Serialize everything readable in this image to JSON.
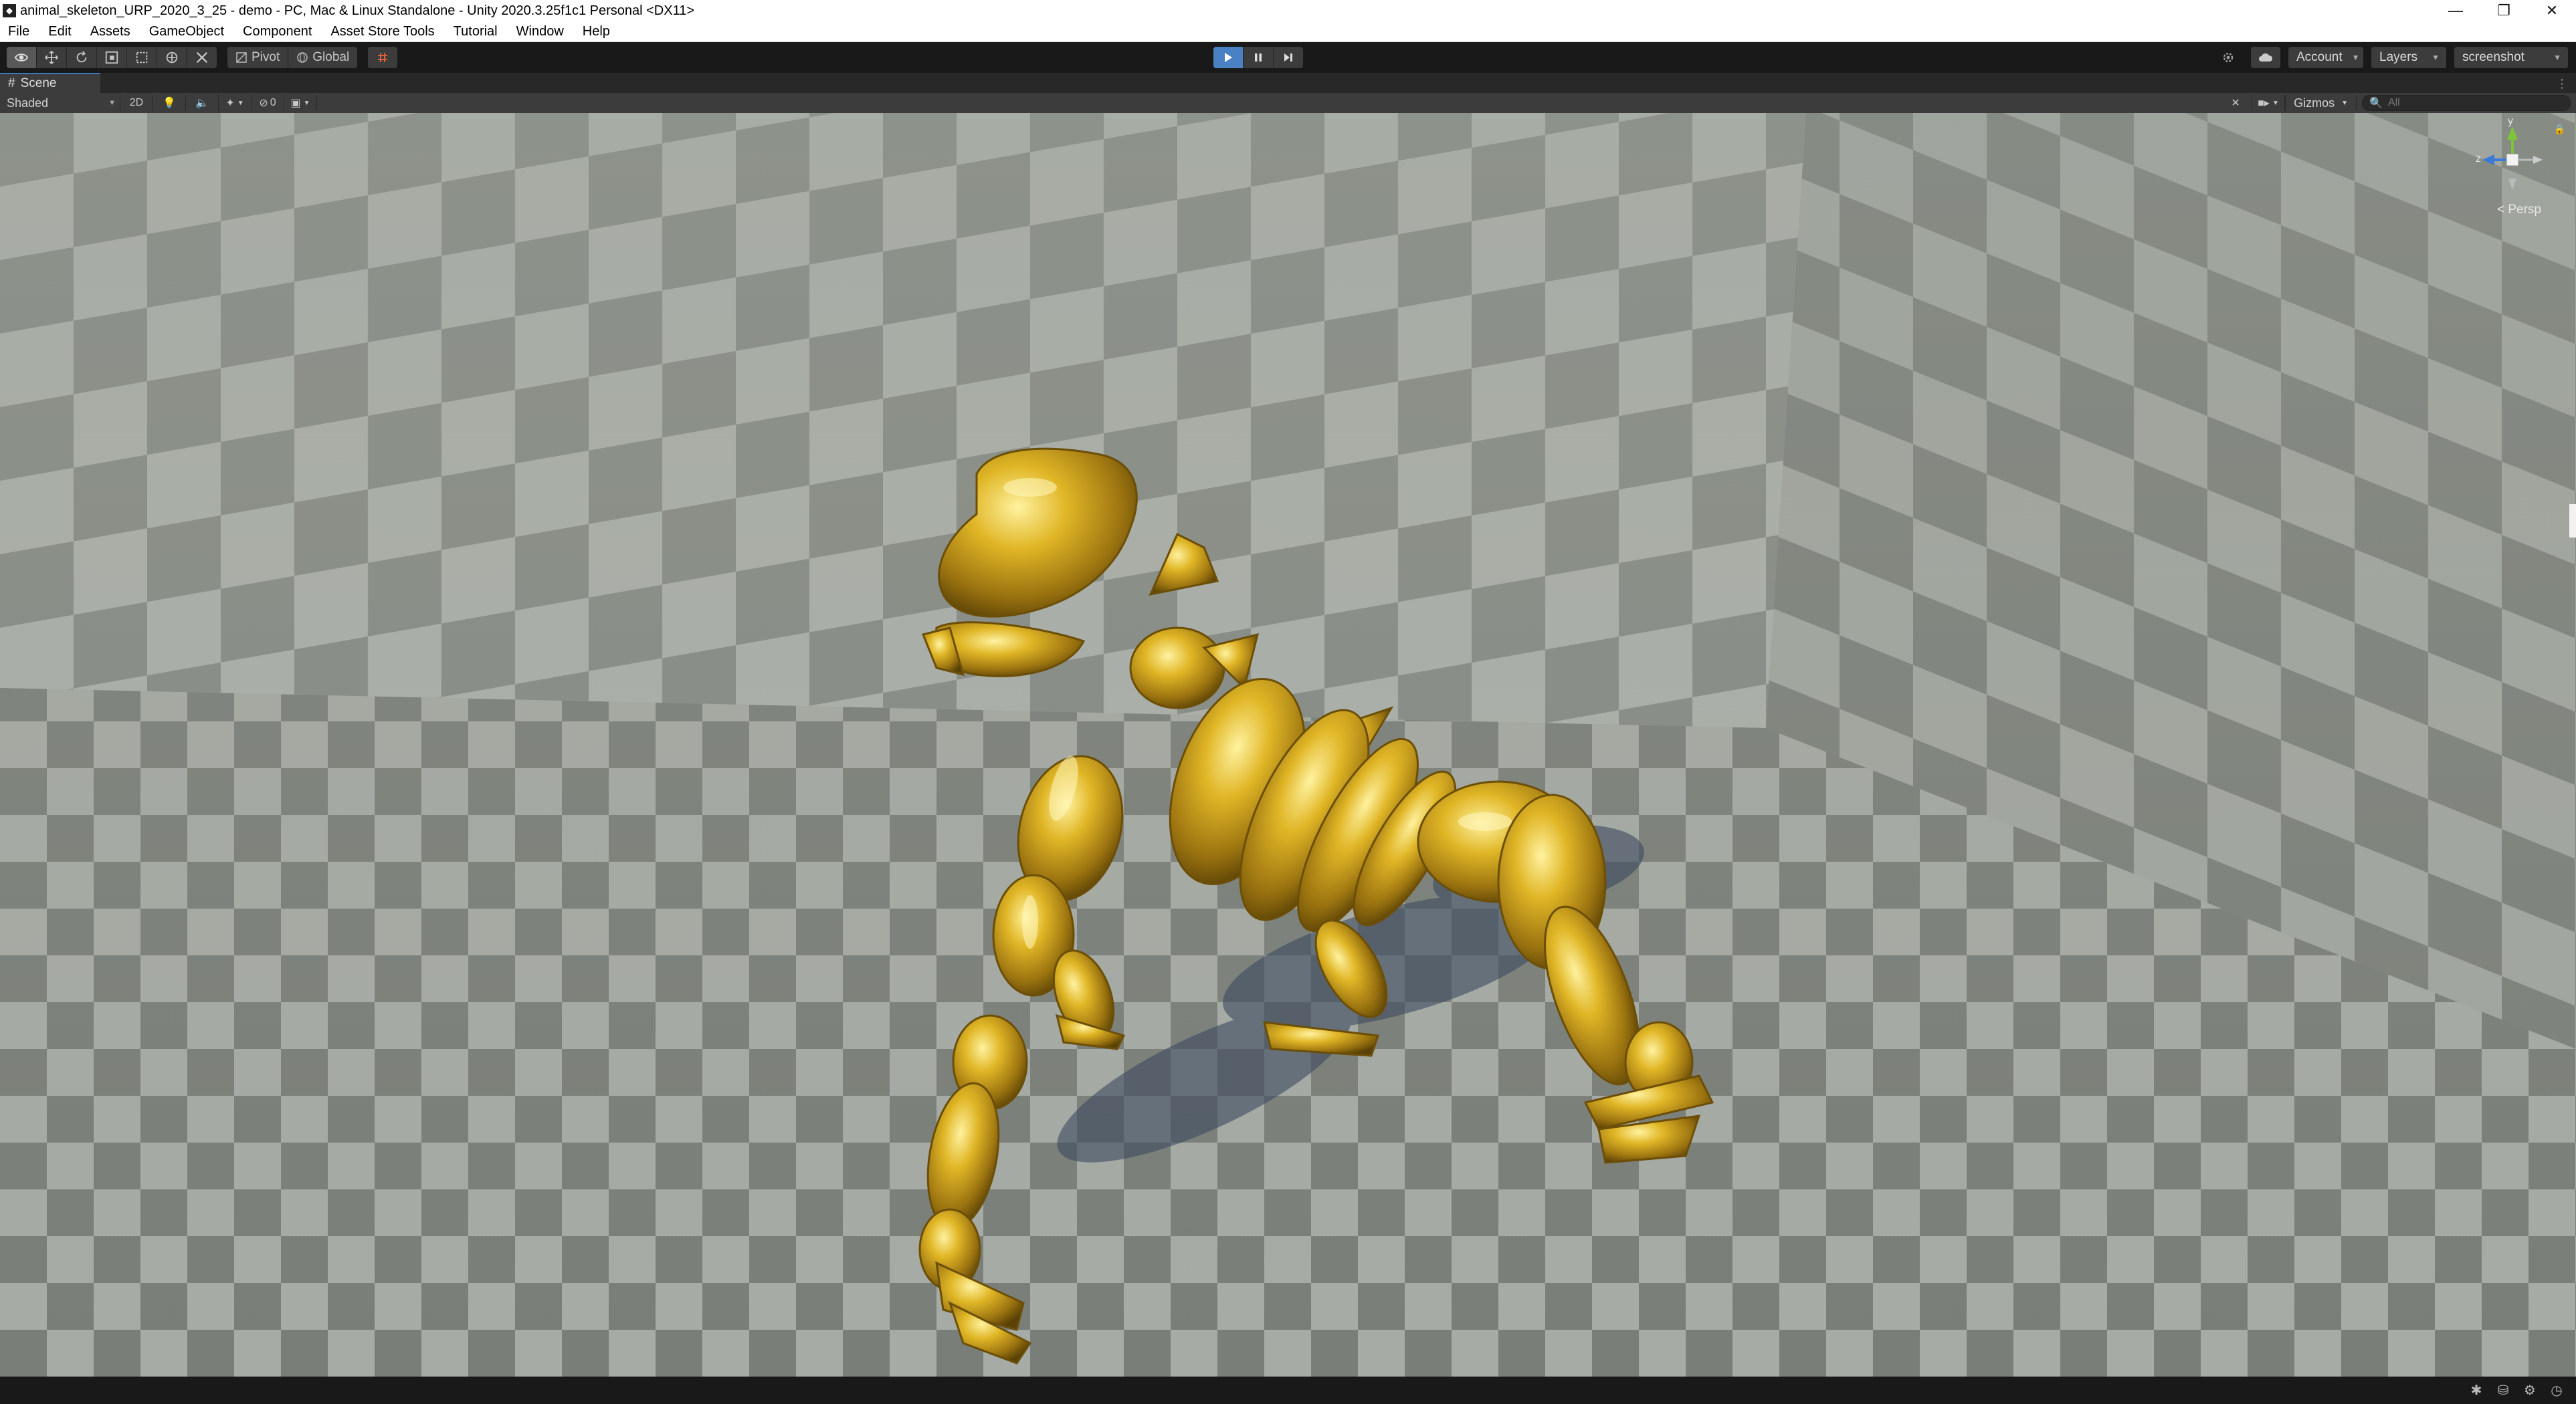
{
  "window": {
    "title": "animal_skeleton_URP_2020_3_25 - demo - PC, Mac & Linux Standalone - Unity 2020.3.25f1c1 Personal <DX11>",
    "app_icon": "unity-icon",
    "controls": {
      "minimize": "—",
      "restore": "❐",
      "close": "✕"
    }
  },
  "menu": [
    "File",
    "Edit",
    "Assets",
    "GameObject",
    "Component",
    "Asset Store Tools",
    "Tutorial",
    "Window",
    "Help"
  ],
  "toolbar": {
    "tools": [
      "view-tool-icon",
      "move-tool-icon",
      "rotate-tool-icon",
      "scale-tool-icon",
      "rect-tool-icon",
      "transform-tool-icon",
      "custom-tool-icon"
    ],
    "pivot_label": "Pivot",
    "global_label": "Global",
    "play_state": "playing",
    "account_label": "Account",
    "layers_label": "Layers",
    "layout_label": "screenshot",
    "accent_color": "#4a80c4"
  },
  "scene_tab": {
    "label": "Scene",
    "icon": "hash-icon",
    "menu_glyph": "⋮"
  },
  "scene_controls": {
    "shading_mode": "Shaded",
    "mode_2d_label": "2D",
    "hidden_count": "0",
    "gizmos_label": "Gizmos",
    "search_placeholder": "All"
  },
  "orientation_gizmo": {
    "axis_y": "y",
    "axis_z": "z",
    "projection_label": "< Persp"
  },
  "colors": {
    "skeleton_gold": "#d4a91e",
    "checker_light": "#a6aaa4",
    "checker_dark": "#6d716b"
  }
}
